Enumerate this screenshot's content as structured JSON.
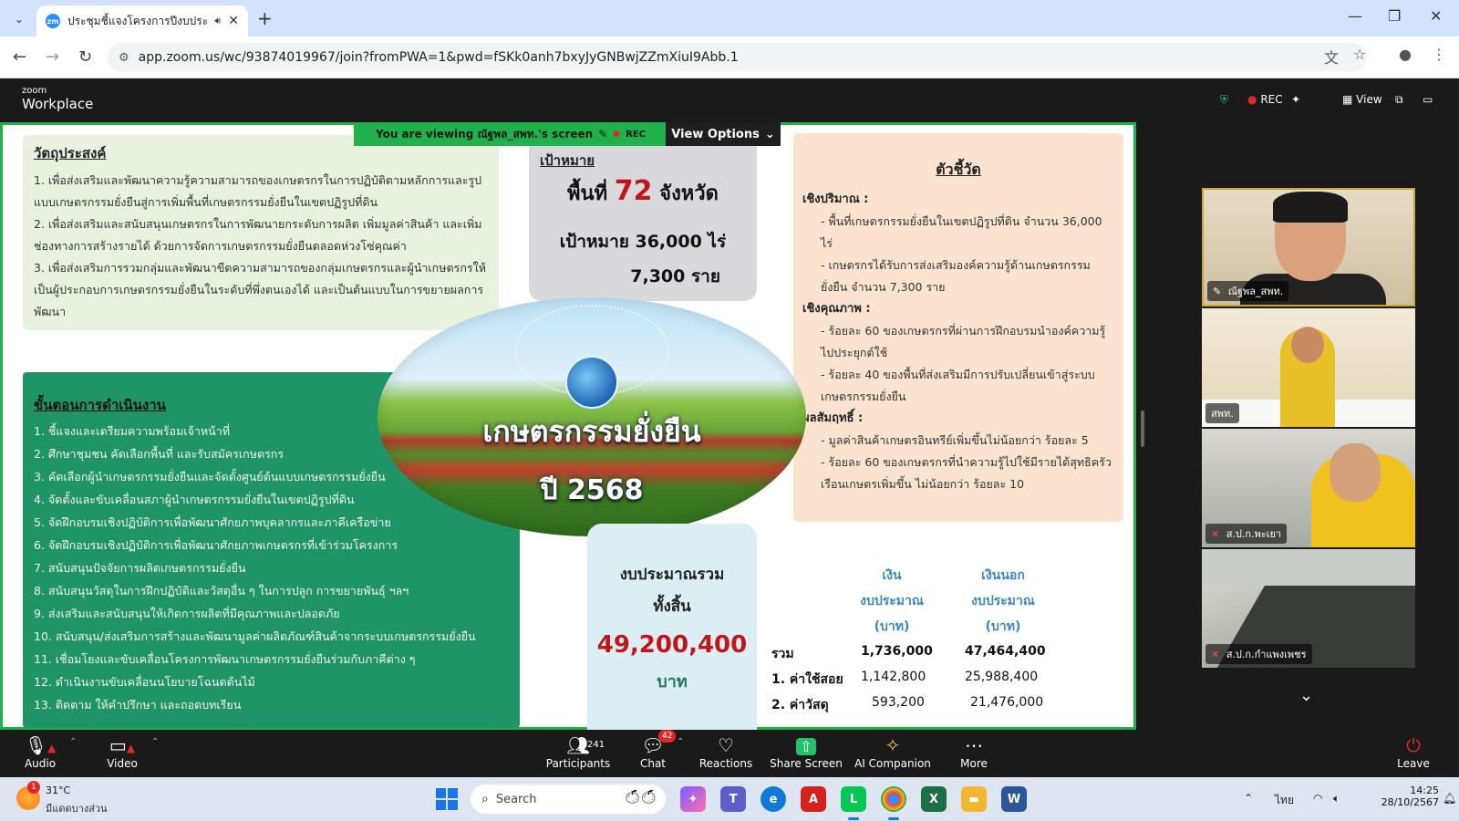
{
  "browser": {
    "tab_title": "ประชุมชี้แจงโครงการปีงบประมาณ",
    "url": "app.zoom.us/wc/93874019967/join?fromPWA=1&pwd=fSKk0anh7bxyJyGNBwjZZmXiuI9Abb.1"
  },
  "zoom_header": {
    "logo_small": "zoom",
    "logo": "Workplace",
    "rec": "REC",
    "view": "View"
  },
  "share_banner": {
    "viewing": "You are viewing ณัฐพล_สพท.'s screen",
    "rec": "REC",
    "view_options": "View Options"
  },
  "slide": {
    "objectives": {
      "title": "วัตถุประสงค์",
      "items": [
        "1. เพื่อส่งเสริมและพัฒนาความรู้ความสามารถของเกษตรกรในการปฏิบัติตามหลักการและรูปแบบเกษตรกรรมยั่งยืนสู่การเพิ่มพื้นที่เกษตรกรรมยั่งยืนในเขตปฏิรูปที่ดิน",
        "2. เพื่อส่งเสริมและสนับสนุนเกษตรกรในการพัฒนายกระดับการผลิต เพิ่มมูลค่าสินค้า และเพิ่มช่องทางการสร้างรายได้ ด้วยการจัดการเกษตรกรรมยั่งยืนตลอดห่วงโซ่คุณค่า",
        "3. เพื่อส่งเสริมการรวมกลุ่มและพัฒนาขีดความสามารถของกลุ่มเกษตรกรและผู้นำเกษตรกรให้เป็นผู้ประกอบการเกษตรกรรมยั่งยืนในระดับที่พึ่งตนเองได้ และเป็นต้นแบบในการขยายผลการพัฒนา"
      ]
    },
    "target": {
      "label": "เป้าหมาย",
      "area_prefix": "พื้นที่",
      "area_num": "72",
      "area_suffix": "จังหวัด",
      "goal": "เป้าหมาย 36,000 ไร่",
      "people": "7,300 ราย"
    },
    "center": {
      "title": "เกษตรกรรมยั่งยืน",
      "year": "ปี 2568"
    },
    "kpi": {
      "title": "ตัวชี้วัด",
      "quantity_head": "เชิงปริมาณ :",
      "quantity": [
        "- พื้นที่เกษตรกรรมยั่งยืนในเขตปฏิรูปที่ดิน จำนวน 36,000 ไร่",
        "- เกษตรกรได้รับการส่งเสริมองค์ความรู้ด้านเกษตรกรรมยั่งยืน จำนวน 7,300 ราย"
      ],
      "quality_head": "เชิงคุณภาพ :",
      "quality": [
        "- ร้อยละ 60 ของเกษตรกรที่ผ่านการฝึกอบรมนำองค์ความรู้ไปประยุกต์ใช้",
        "- ร้อยละ 40 ของพื้นที่ส่งเสริมมีการปรับเปลี่ยนเข้าสู่ระบบเกษตรกรรมยั่งยืน"
      ],
      "outcome_head": "ผลสัมฤทธิ์ :",
      "outcome": [
        "- มูลค่าสินค้าเกษตรอินทรีย์เพิ่มขึ้นไม่น้อยกว่า ร้อยละ 5",
        "- ร้อยละ 60 ของเกษตรกรที่นำความรู้ไปใช้มีรายได้สุทธิครัวเรือนเกษตรเพิ่มขึ้น ไม่น้อยกว่า ร้อยละ 10"
      ]
    },
    "steps": {
      "title": "ขั้นตอนการดำเนินงาน",
      "items": [
        "1. ชี้แจงและเตรียมความพร้อมเจ้าหน้าที่",
        "2. ศึกษาชุมชน คัดเลือกพื้นที่ และรับสมัครเกษตรกร",
        "3. คัดเลือกผู้นำเกษตรกรรมยั่งยืนและจัดตั้งศูนย์ต้นแบบเกษตรกรรมยั่งยืน",
        "4. จัดตั้งและขับเคลื่อนสภาผู้นำเกษตรกรรมยั่งยืนในเขตปฏิรูปที่ดิน",
        "5. จัดฝึกอบรมเชิงปฏิบัติการเพื่อพัฒนาศักยภาพบุคลากรและภาคีเครือข่าย",
        "6. จัดฝึกอบรมเชิงปฏิบัติการเพื่อพัฒนาศักยภาพเกษตรกรที่เข้าร่วมโครงการ",
        "7. สนับสนุนปัจจัยการผลิตเกษตรกรรมยั่งยืน",
        "8. สนับสนุนวัสดุในการฝึกปฏิบัติและวัสดุอื่น ๆ ในการปลูก การขยายพันธุ์ ฯลฯ",
        "9. ส่งเสริมและสนับสนุนให้เกิดการผลิตที่มีคุณภาพและปลอดภัย",
        "10. สนับสนุน/ส่งเสริมการสร้างและพัฒนามูลค่าผลิตภัณฑ์สินค้าจากระบบเกษตรกรรมยั่งยืน",
        "11. เชื่อมโยงและขับเคลื่อนโครงการพัฒนาเกษตรกรรมยั่งยืนร่วมกับภาคีต่าง ๆ",
        "12. ดำเนินงานขับเคลื่อนนโยบายโฉนดต้นไม้",
        "13. ติดตาม ให้คำปรึกษา และถอดบทเรียน"
      ]
    },
    "budget": {
      "title1": "งบประมาณรวม",
      "title2": "ทั้งสิ้น",
      "amount": "49,200,400",
      "unit": "บาท"
    },
    "budget_table": {
      "col1": [
        "เงิน",
        "งบประมาณ",
        "(บาท)"
      ],
      "col2": [
        "เงินนอก",
        "งบประมาณ",
        "(บาท)"
      ],
      "rows": [
        {
          "label": "รวม",
          "v1": "1,736,000",
          "v2": "47,464,400"
        },
        {
          "label": "1. ค่าใช้สอย",
          "v1": "1,142,800",
          "v2": "25,988,400"
        },
        {
          "label": "2. ค่าวัสดุ",
          "v1": "593,200",
          "v2": "21,476,000"
        }
      ]
    }
  },
  "participants": [
    {
      "name": "ณัฐพล_สพท."
    },
    {
      "name": "สพท."
    },
    {
      "name": "ส.ป.ก.พะเยา"
    },
    {
      "name": "ส.ป.ก.กำแพงเพชร"
    }
  ],
  "footer": {
    "audio": "Audio",
    "video": "Video",
    "participants": "Participants",
    "participants_count": "241",
    "chat": "Chat",
    "chat_badge": "42",
    "reactions": "Reactions",
    "share_screen": "Share Screen",
    "ai_companion": "AI Companion",
    "more": "More",
    "leave": "Leave"
  },
  "taskbar": {
    "weather_temp": "31°C",
    "weather_desc": "มีแดดบางส่วน",
    "weather_badge": "1",
    "search_placeholder": "Search",
    "lang": "ไทย",
    "time": "14:25",
    "date": "28/10/2567"
  }
}
